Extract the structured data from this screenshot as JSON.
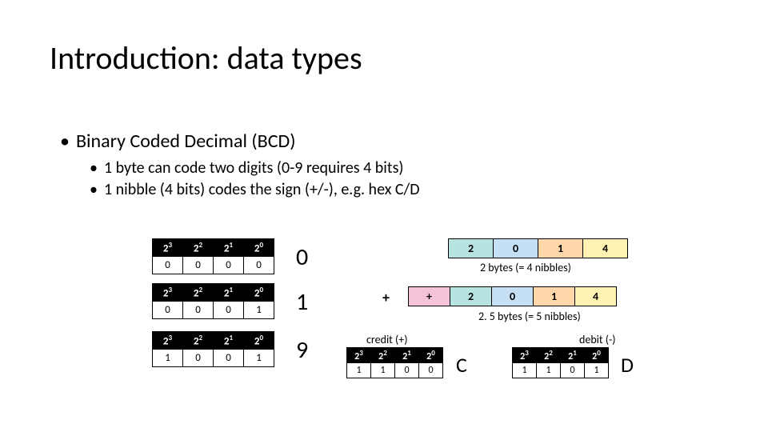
{
  "title": "Introduction: data types",
  "bullets": {
    "l1": "Binary Coded Decimal (BCD)",
    "l2a": "1 byte can code two digits (0-9 requires 4 bits)",
    "l2b": "1 nibble (4 bits) codes the sign (+/-), e.g. hex C/D"
  },
  "powHeaders": {
    "p3": "3",
    "p2": "2",
    "p1": "1",
    "p0": "0",
    "base": "2"
  },
  "nibble0": {
    "b3": "0",
    "b2": "0",
    "b1": "0",
    "b0": "0",
    "digit": "0"
  },
  "nibble1": {
    "b3": "0",
    "b2": "0",
    "b1": "0",
    "b0": "1",
    "digit": "1"
  },
  "nibble9": {
    "b3": "1",
    "b2": "0",
    "b1": "0",
    "b0": "1",
    "digit": "9"
  },
  "row4": {
    "a": "2",
    "b": "0",
    "c": "1",
    "d": "4",
    "caption": "2 bytes (= 4 nibbles)"
  },
  "row5": {
    "sign": "+",
    "a": "2",
    "b": "0",
    "c": "1",
    "d": "4",
    "caption": "2. 5 bytes (= 5 nibbles)"
  },
  "plus": "+",
  "credit": {
    "label": "credit (+)",
    "b3": "1",
    "b2": "1",
    "b1": "0",
    "b0": "0",
    "hex": "C"
  },
  "debit": {
    "label": "debit (-)",
    "b3": "1",
    "b2": "1",
    "b1": "0",
    "b0": "1",
    "hex": "D"
  }
}
